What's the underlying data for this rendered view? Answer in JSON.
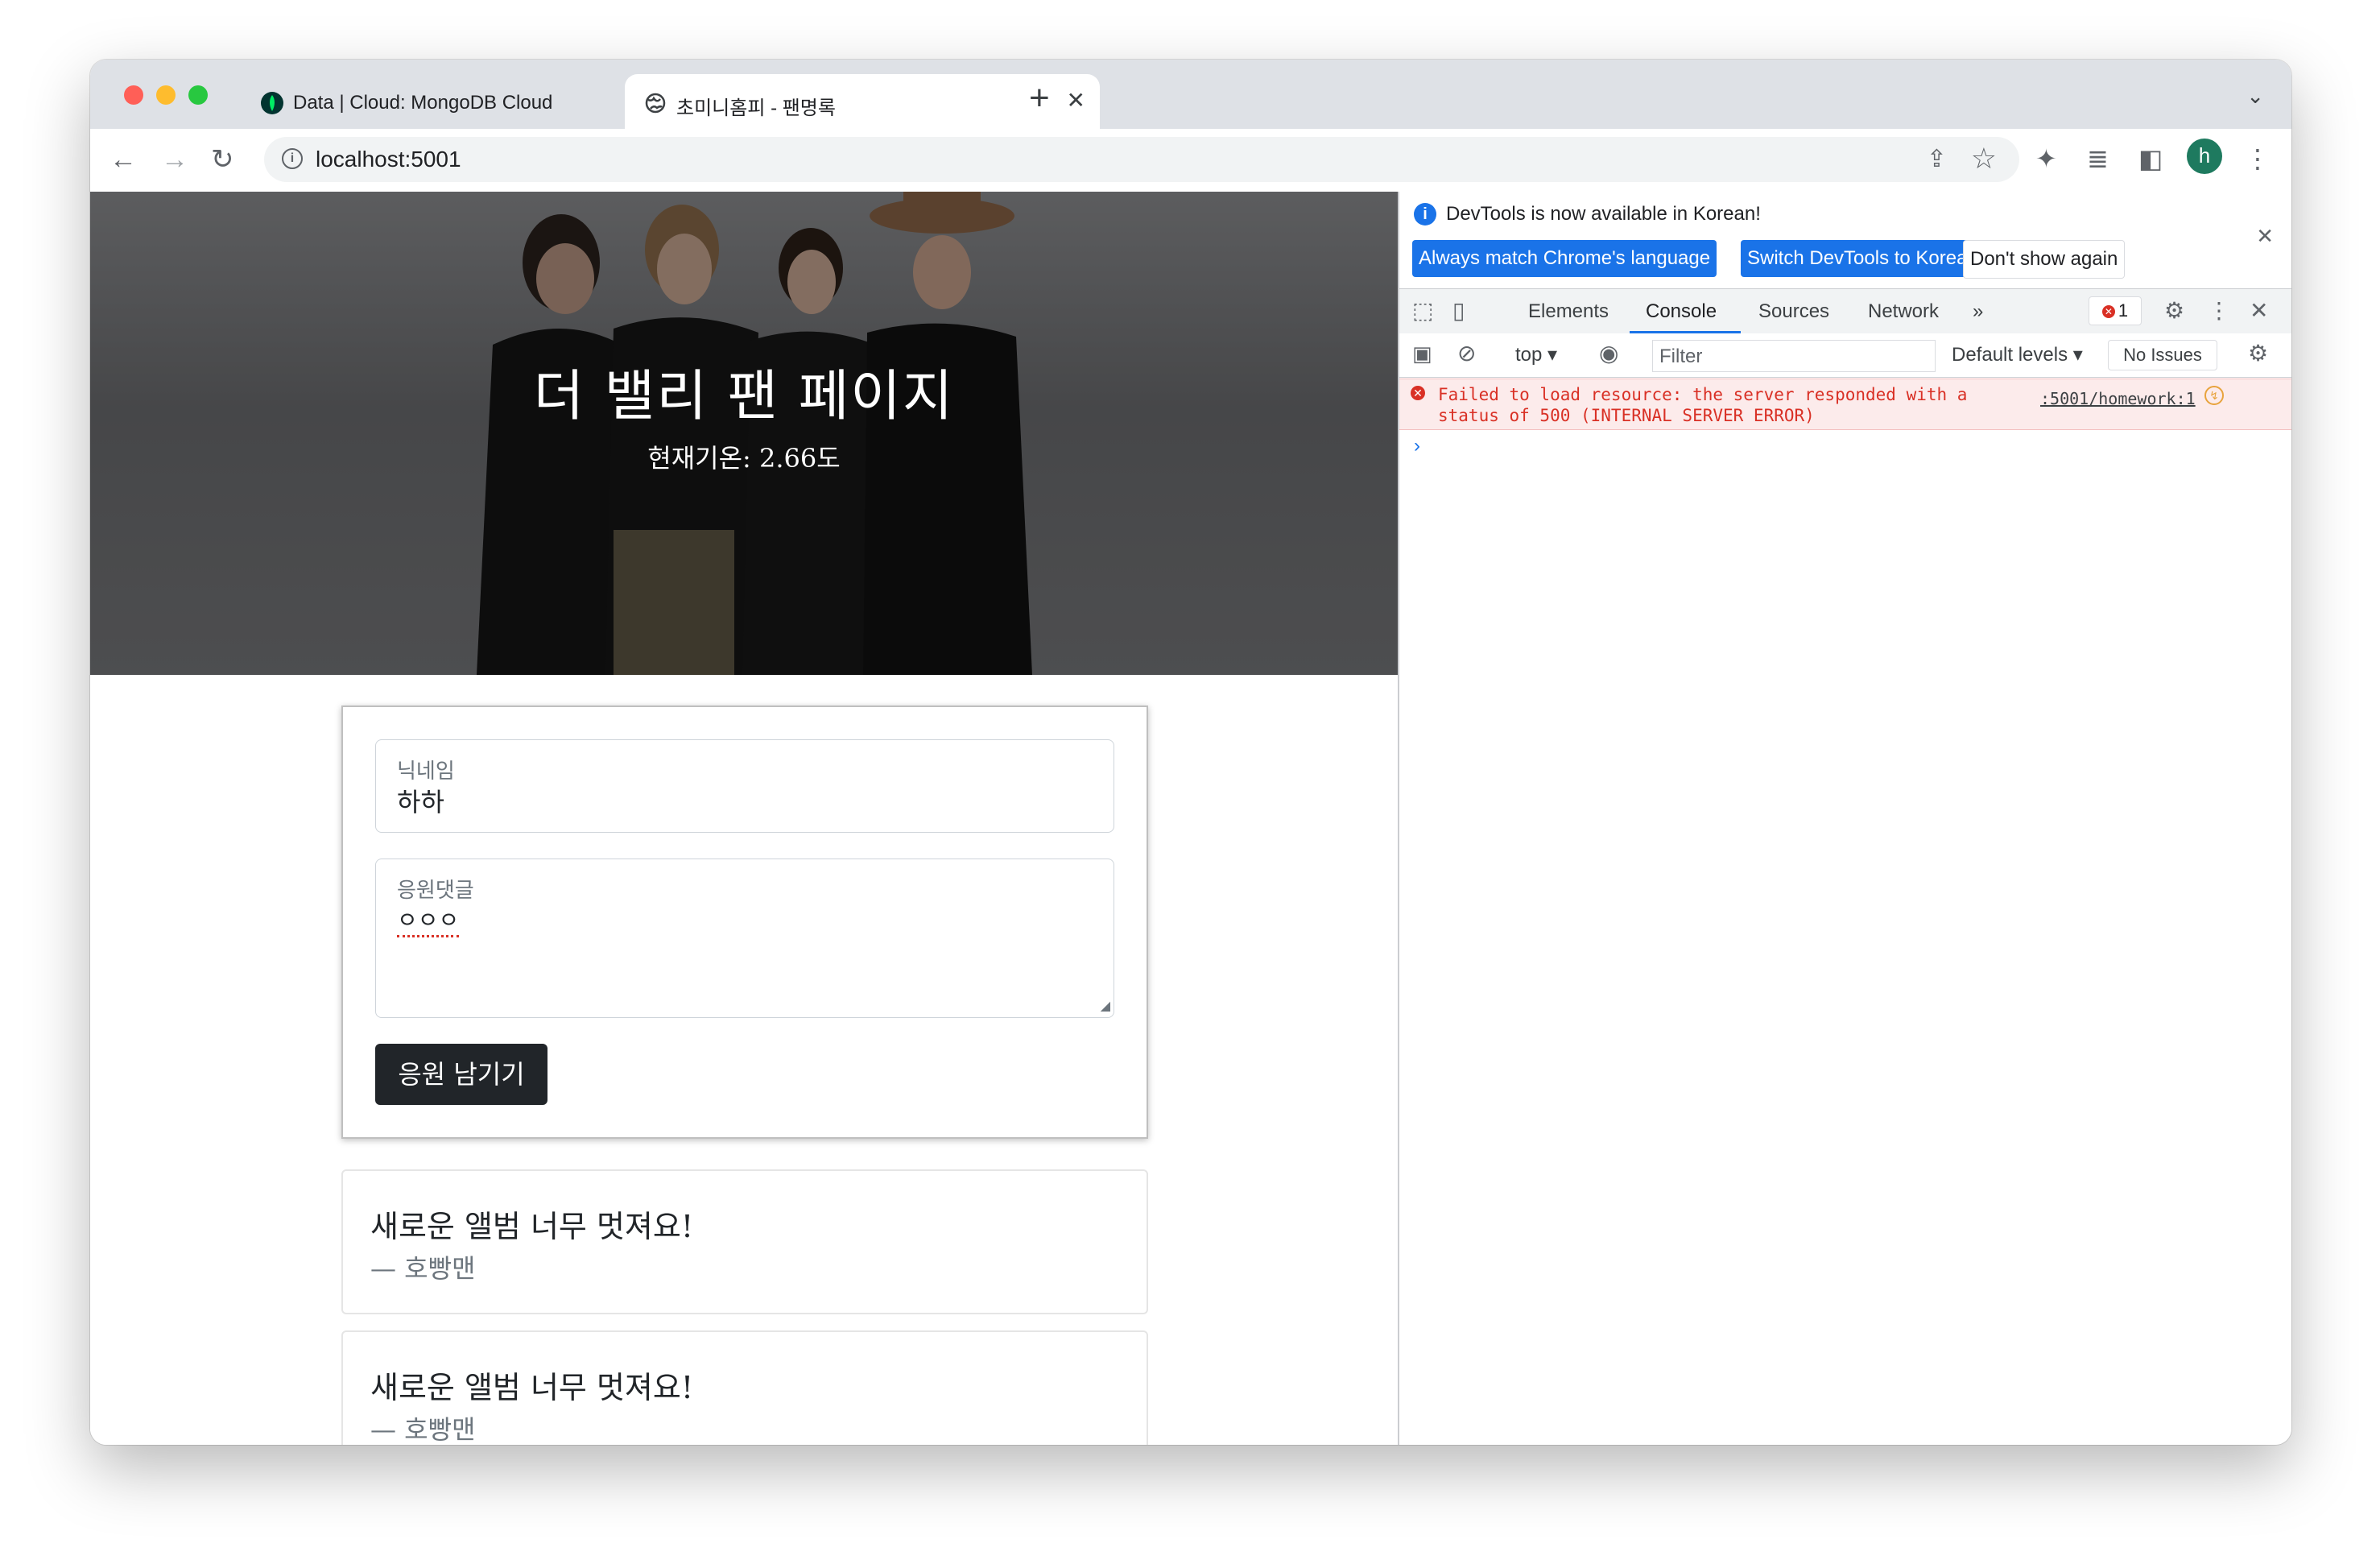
{
  "browser": {
    "tabs": [
      {
        "title": "Data | Cloud: MongoDB Cloud",
        "active": false
      },
      {
        "title": "초미니홈피 - 팬명록",
        "active": true
      }
    ],
    "url": "localhost:5001",
    "profile_initial": "h"
  },
  "page": {
    "hero": {
      "title": "더 밸리 팬 페이지",
      "temperature": "현재기온: 2.66도"
    },
    "form": {
      "nickname_label": "닉네임",
      "nickname_value": "하하",
      "comment_label": "응원댓글",
      "comment_value": "ㅇㅇㅇ",
      "submit_label": "응원 남기기"
    },
    "comments": [
      {
        "text": "새로운 앨범 너무 멋져요!",
        "author": "— 호빵맨"
      },
      {
        "text": "새로운 앨범 너무 멋져요!",
        "author": "— 호빵맨"
      }
    ]
  },
  "devtools": {
    "notice": "DevTools is now available in Korean!",
    "notice_buttons": [
      "Always match Chrome's language",
      "Switch DevTools to Korean",
      "Don't show again"
    ],
    "tabs": [
      "Elements",
      "Console",
      "Sources",
      "Network"
    ],
    "active_tab": "Console",
    "error_count": "1",
    "context": "top",
    "filter_placeholder": "Filter",
    "levels": "Default levels",
    "issues": "No Issues",
    "error_message": "Failed to load resource: the server responded with a\nstatus of 500 (INTERNAL SERVER ERROR)",
    "error_source": ":5001/homework:1"
  },
  "colors": {
    "accent": "#1a73e8",
    "error": "#d93025",
    "button_dark": "#212529",
    "avatar": "#1e7a5f"
  }
}
